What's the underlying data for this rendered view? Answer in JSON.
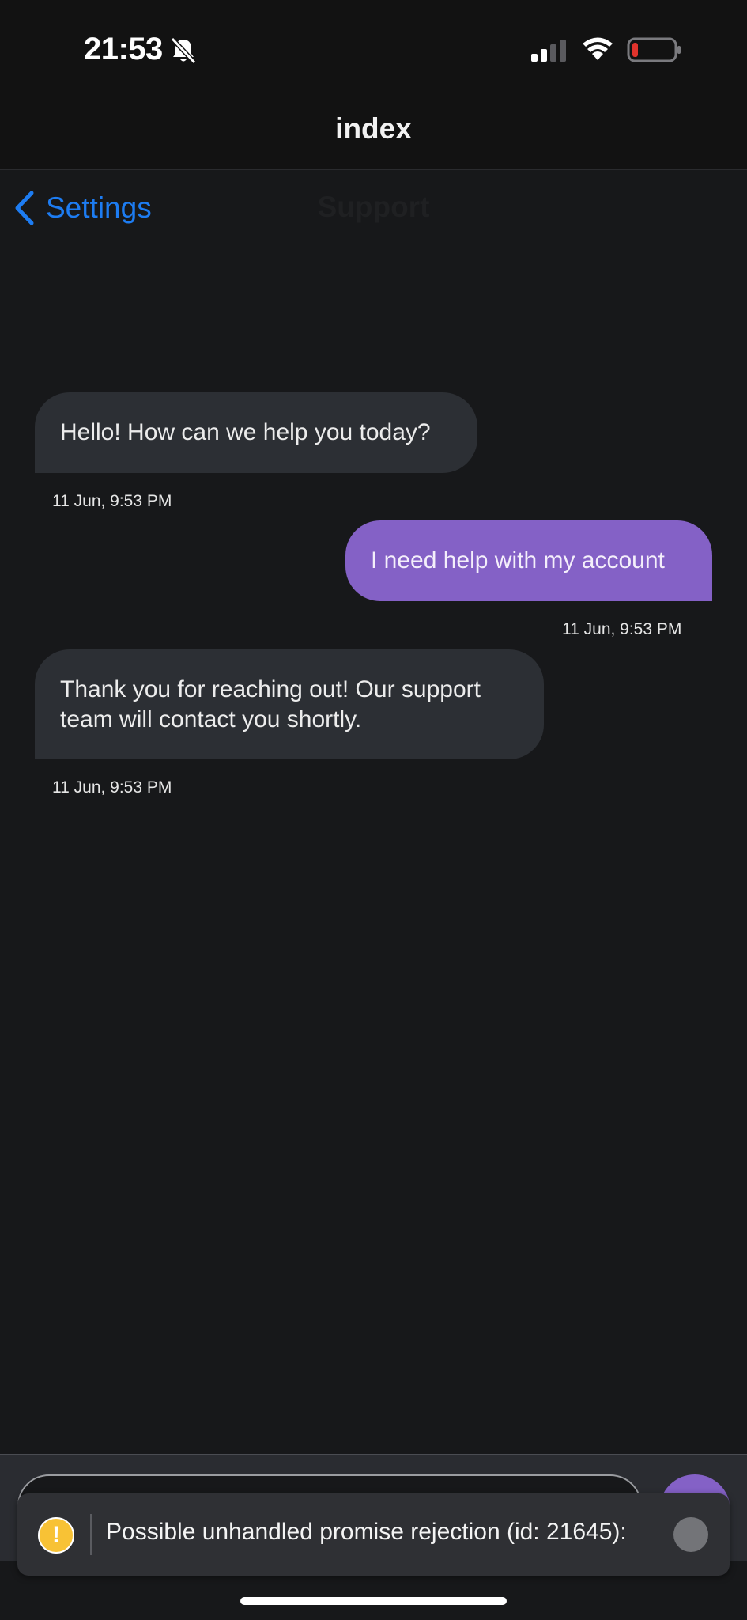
{
  "status_bar": {
    "time": "21:53",
    "icons": [
      "bell-slash-icon",
      "signal-icon",
      "wifi-icon",
      "battery-low-icon"
    ],
    "battery_color": "#e0332c"
  },
  "header": {
    "title": "index"
  },
  "nav": {
    "back_label": "Settings",
    "title": "Support"
  },
  "messages": [
    {
      "direction": "incoming",
      "text": "Hello! How can we help you today?",
      "time": "11 Jun, 9:53 PM"
    },
    {
      "direction": "outgoing",
      "text": "I need help with my account",
      "time": "11 Jun, 9:53 PM"
    },
    {
      "direction": "incoming",
      "text": "Thank you for reaching out! Our support team will contact you shortly.",
      "time": "11 Jun, 9:53 PM"
    }
  ],
  "toast": {
    "icon": "!",
    "message": "Possible unhandled promise rejection (id: 21645):"
  },
  "colors": {
    "accent": "#1d7cf2",
    "outgoing_bubble": "#8461c6",
    "incoming_bubble": "#2c2f34",
    "warning": "#f8c235"
  }
}
